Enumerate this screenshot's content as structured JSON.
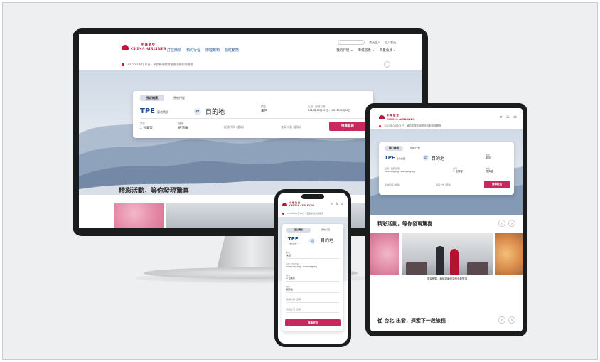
{
  "brand": {
    "name_en": "CHINA AIRLINES",
    "name_cn": "中華航空",
    "accent": "#c8102e",
    "blue": "#1d4f91",
    "search_button_color": "#c8285e"
  },
  "desktop": {
    "nav_links": [
      "訂位購票",
      "預約行程",
      "辦理報到",
      "航班動態"
    ],
    "utility": {
      "login": "會員登入",
      "register": "加入會員"
    },
    "menu": [
      "我的行程 ⌄",
      "準備搭機 ⌄",
      "華夏會員 ⌄"
    ],
    "notice": "2024年06月01日 - 華航新建航線優惠活動即將開跑",
    "booking": {
      "tabs": [
        "預訂機票",
        "預約行程"
      ],
      "origin_code": "TPE",
      "origin_name": "臺北桃園",
      "destination": "目的地",
      "trip_label": "類型",
      "trip_value": "來回",
      "date_label": "出發 / 回程日期",
      "date_value": "2024年05月31日 - 2024年06月06日",
      "passenger_label": "乘客",
      "passenger_value": "1 位乘客",
      "cabin_label": "艙等",
      "cabin_value": "經濟艙",
      "promo_placeholder": "促銷代碼 (選填)",
      "member_placeholder": "會員卡號 (選填)",
      "search": "搜尋航班"
    },
    "promo_title": "精彩活動，等你發現驚喜"
  },
  "tablet": {
    "promo_title": "精彩活動，等你發現驚喜",
    "caption": "尊榮體驗，華航豪華經濟艙全新登場",
    "explore_title": "從 台北 出發，探索下一段旅程",
    "explore_city": "台北"
  },
  "phone": {
    "notice": "2024年06月01日 - 華航新建航線優惠",
    "origin_code": "TPE",
    "origin_name": "臺北桃園",
    "destination": "目的地"
  }
}
